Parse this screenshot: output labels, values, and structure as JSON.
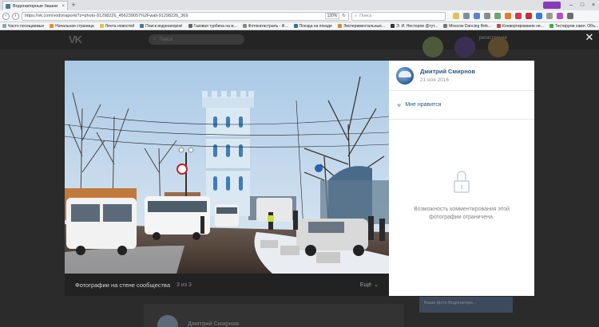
{
  "browser": {
    "tab_title": "Водонапорные башни Росс",
    "url": "https://vk.com/vodonaporki?z=photo-91298226_456239057%2Fwall-91298226_369",
    "zoom": "120%",
    "search_placeholder": "Поиск",
    "bookmarks": [
      "Часто посещаемые",
      "Начальная страница",
      "Лента новостей",
      "Поиск водонапорок!",
      "Газовая турбина на ж...",
      "Фотокатастраль - Ф...",
      "Поезда на поезде",
      "Экспериментальные...",
      "Э. И. Нестеров @тут...",
      "Moscow Dancing Reb...",
      "Конвертирование не...",
      "Тестируем самл. Объ..."
    ]
  },
  "vk": {
    "logo": "VK",
    "search_placeholder": "Поиск",
    "register_link": "регистрация",
    "background_author": "Дмитрий Смирнов",
    "background_album": "Ваши фото Водонапорк..."
  },
  "viewer": {
    "album_label": "Фотографии на стене сообщества",
    "counter": "3 из 3",
    "more_label": "Ещё",
    "author": {
      "name": "Дмитрий Смирнов",
      "date": "21 ноя 2016"
    },
    "like_label": "Мне нравится",
    "comments_disabled": "Возможность комментирования этой фотографии ограничена."
  }
}
